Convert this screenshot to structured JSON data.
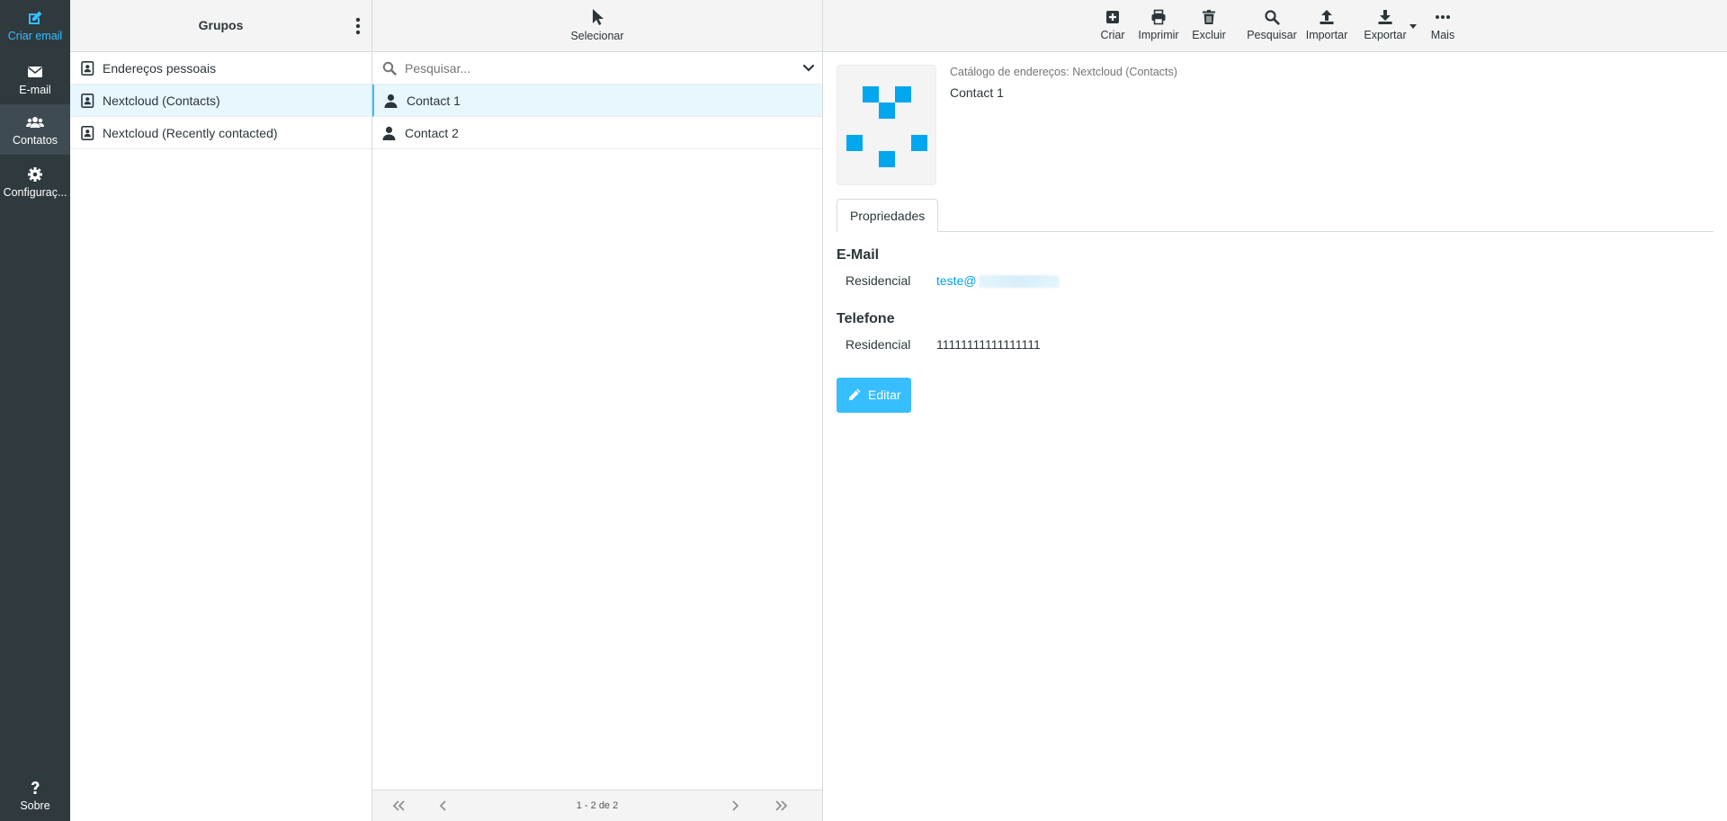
{
  "nav": {
    "compose": {
      "label": "Criar email",
      "icon": "compose-icon"
    },
    "mail": {
      "label": "E-mail",
      "icon": "envelope-icon"
    },
    "contacts": {
      "label": "Contatos",
      "icon": "users-icon"
    },
    "settings": {
      "label": "Configuraç...",
      "icon": "gear-icon"
    },
    "about": {
      "label": "Sobre",
      "icon": "question-icon"
    }
  },
  "groups": {
    "title": "Grupos",
    "items": [
      {
        "label": "Endereços pessoais",
        "selected": false
      },
      {
        "label": "Nextcloud (Contacts)",
        "selected": true
      },
      {
        "label": "Nextcloud (Recently contacted)",
        "selected": false
      }
    ]
  },
  "list": {
    "select_label": "Selecionar",
    "search_placeholder": "Pesquisar...",
    "contacts": [
      {
        "name": "Contact 1",
        "selected": true
      },
      {
        "name": "Contact 2",
        "selected": false
      }
    ],
    "pager_info": "1 - 2 de 2"
  },
  "toolbar": {
    "create": "Criar",
    "print": "Imprimir",
    "delete": "Excluir",
    "search": "Pesquisar",
    "import": "Importar",
    "export": "Exportar",
    "more": "Mais"
  },
  "contact": {
    "address_book": "Catálogo de endereços: Nextcloud (Contacts)",
    "name": "Contact 1",
    "tab": "Propriedades",
    "email_section": "E-Mail",
    "email_type": "Residencial",
    "email_value": "teste@",
    "phone_section": "Telefone",
    "phone_type": "Residencial",
    "phone_value": "11111111111111111",
    "edit_label": "Editar"
  },
  "colors": {
    "accent": "#37beff",
    "nav_bg": "#2f3a3f",
    "link": "#00a0e9",
    "selected_row": "#e8f6fd"
  }
}
